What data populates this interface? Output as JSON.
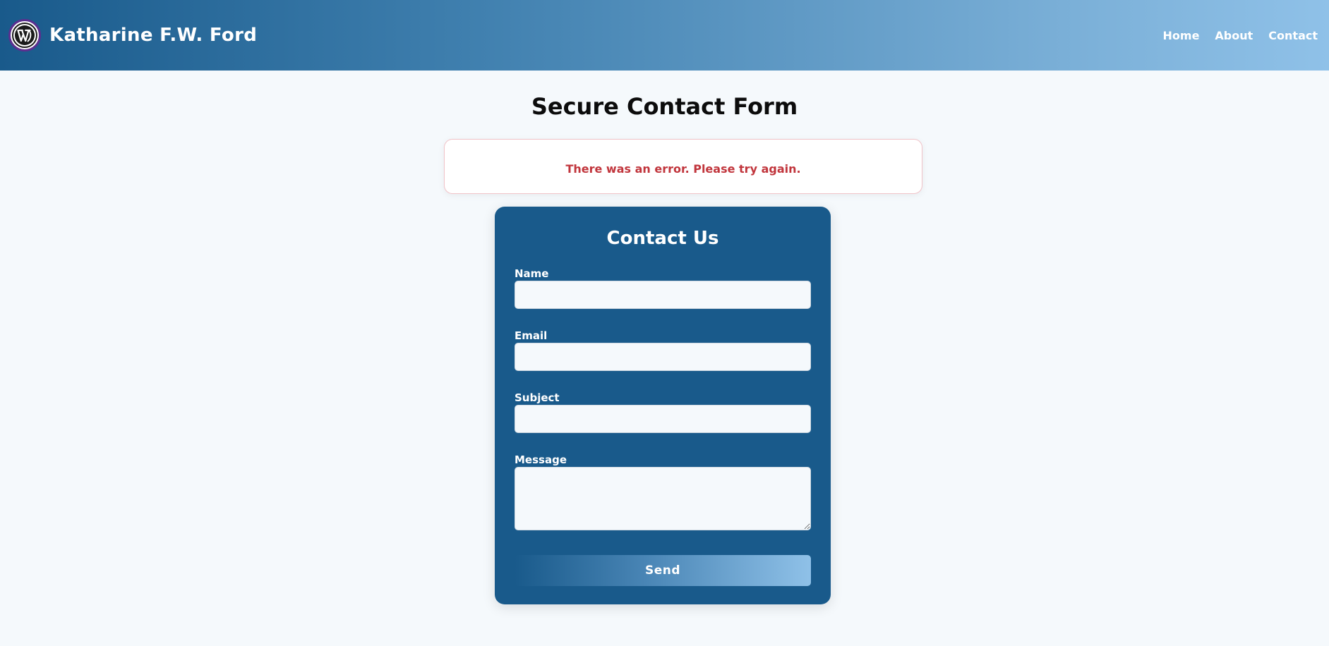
{
  "header": {
    "site_title": "Katharine F.W. Ford",
    "logo_icon": "wordpress-logo-icon",
    "nav": [
      {
        "label": "Home"
      },
      {
        "label": "About"
      },
      {
        "label": "Contact"
      }
    ]
  },
  "main": {
    "page_title": "Secure Contact Form",
    "error_message": "There was an error. Please try again."
  },
  "form": {
    "heading": "Contact Us",
    "fields": {
      "name": {
        "label": "Name",
        "value": ""
      },
      "email": {
        "label": "Email",
        "value": ""
      },
      "subject": {
        "label": "Subject",
        "value": ""
      },
      "message": {
        "label": "Message",
        "value": ""
      }
    },
    "submit_label": "Send"
  },
  "colors": {
    "header_gradient_start": "#195a8b",
    "header_gradient_end": "#8fc1e8",
    "form_background": "#195a8b",
    "error_text": "#c1353c",
    "page_background": "#f5f9fc"
  }
}
